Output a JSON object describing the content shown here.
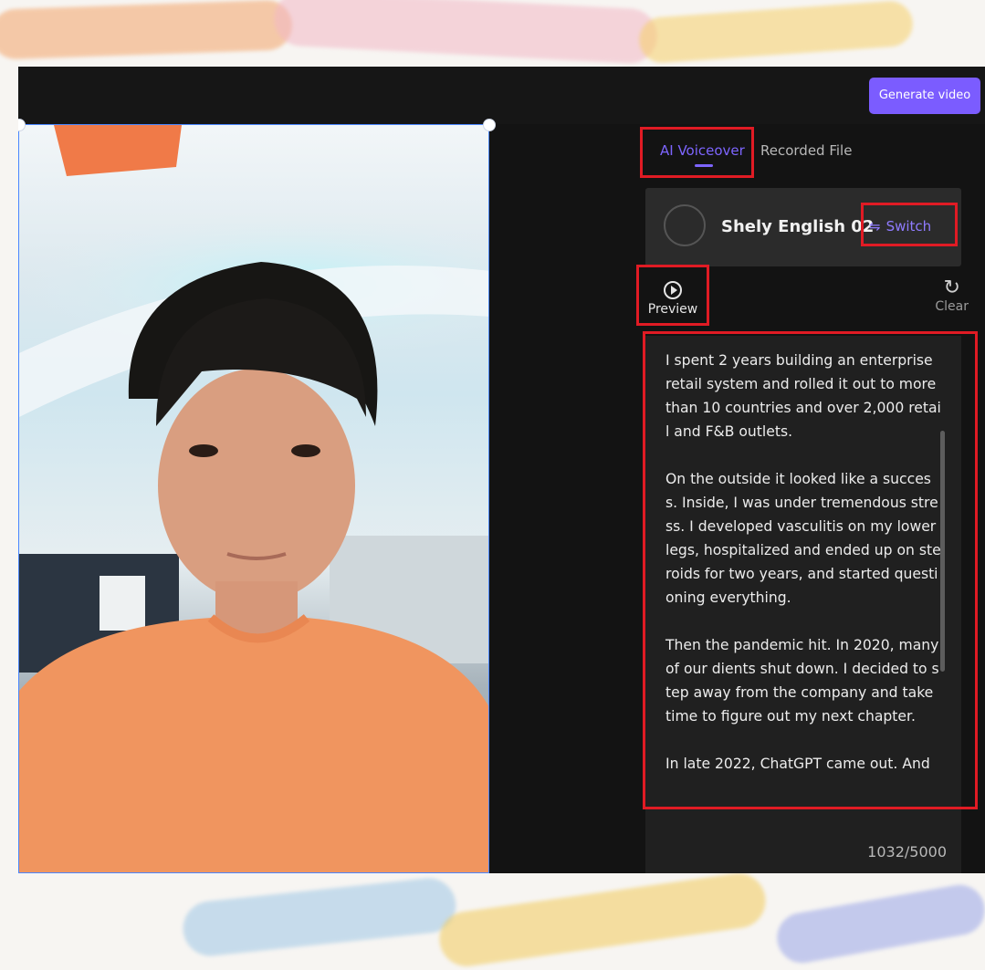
{
  "toolbar": {
    "generate_label": "Generate video"
  },
  "tabs": {
    "active": "AI Voiceover",
    "inactive": "Recorded File"
  },
  "voice": {
    "name": "Shely English 02",
    "switch_label": "Switch"
  },
  "controls": {
    "preview_label": "Preview",
    "clear_label": "Clear"
  },
  "script": {
    "paragraphs": [
      "I spent 2 years building an enterprise retail system and rolled it out to more than 10 countries and over 2,000 retail and F&B outlets.",
      "On the outside it looked like a success. Inside, I was under tremendous stress. I developed vasculitis on my lower legs, hospitalized and ended up on steroids for two years, and started questioning everything.",
      "Then the pandemic hit. In 2020, many of our dients shut down. I decided to step away from the company and take time to figure out my next chapter.",
      "In late 2022, ChatGPT came out. And"
    ],
    "char_count": "1032/5000"
  },
  "colors": {
    "accent": "#7b5cff",
    "highlight": "#e01b24",
    "panel_bg": "#131313"
  },
  "icons": {
    "switch": "swap-arrows-icon",
    "preview": "play-circle-icon",
    "clear": "refresh-icon"
  }
}
